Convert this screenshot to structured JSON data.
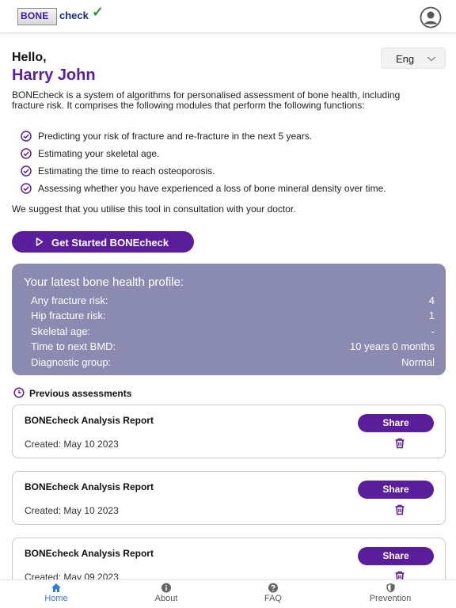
{
  "header": {
    "logo_bone": "BONE",
    "logo_check": "check",
    "logo_tick": "✓",
    "profile_icon": "user-circle-icon"
  },
  "greeting": {
    "hello": "Hello,",
    "name": "Harry John"
  },
  "language": {
    "selected": "Eng"
  },
  "intro_text": "BONEcheck is a system of algorithms for personalised assessment of bone health, including fracture risk. It comprises the following modules that perform the following functions:",
  "features": [
    "Predicting your risk of fracture and re-fracture in the next 5 years.",
    "Estimating your skeletal age.",
    "Estimating the time to reach osteoporosis.",
    "Assessing whether you have experienced a loss of bone mineral density over time."
  ],
  "suggestion": "We suggest that you utilise this tool in consultation with your doctor.",
  "cta_label": "Get Started BONEcheck",
  "profile": {
    "title": "Your latest bone health profile:",
    "rows": [
      {
        "label": "Any fracture risk:",
        "value": "4"
      },
      {
        "label": "Hip fracture risk:",
        "value": "1"
      },
      {
        "label": "Skeletal age:",
        "value": "-"
      },
      {
        "label": "Time to next BMD:",
        "value": "10 years 0 months"
      },
      {
        "label": "Diagnostic group:",
        "value": "Normal"
      }
    ]
  },
  "previous": {
    "heading": "Previous assessments",
    "reports": [
      {
        "title": "BONEcheck Analysis Report",
        "created": "Created: May 10 2023",
        "share": "Share"
      },
      {
        "title": "BONEcheck Analysis Report",
        "created": "Created: May 10 2023",
        "share": "Share"
      },
      {
        "title": "BONEcheck Analysis Report",
        "created": "Created: May 09 2023",
        "share": "Share"
      }
    ]
  },
  "bottom_nav": [
    {
      "label": "Home",
      "icon": "home-icon",
      "active": true
    },
    {
      "label": "About",
      "icon": "info-icon",
      "active": false
    },
    {
      "label": "FAQ",
      "icon": "help-icon",
      "active": false
    },
    {
      "label": "Prevention",
      "icon": "shield-icon",
      "active": false
    }
  ],
  "colors": {
    "primary": "#5a1e9a",
    "card_bg": "#8b8bb2",
    "nav_active": "#2f7bd6"
  }
}
